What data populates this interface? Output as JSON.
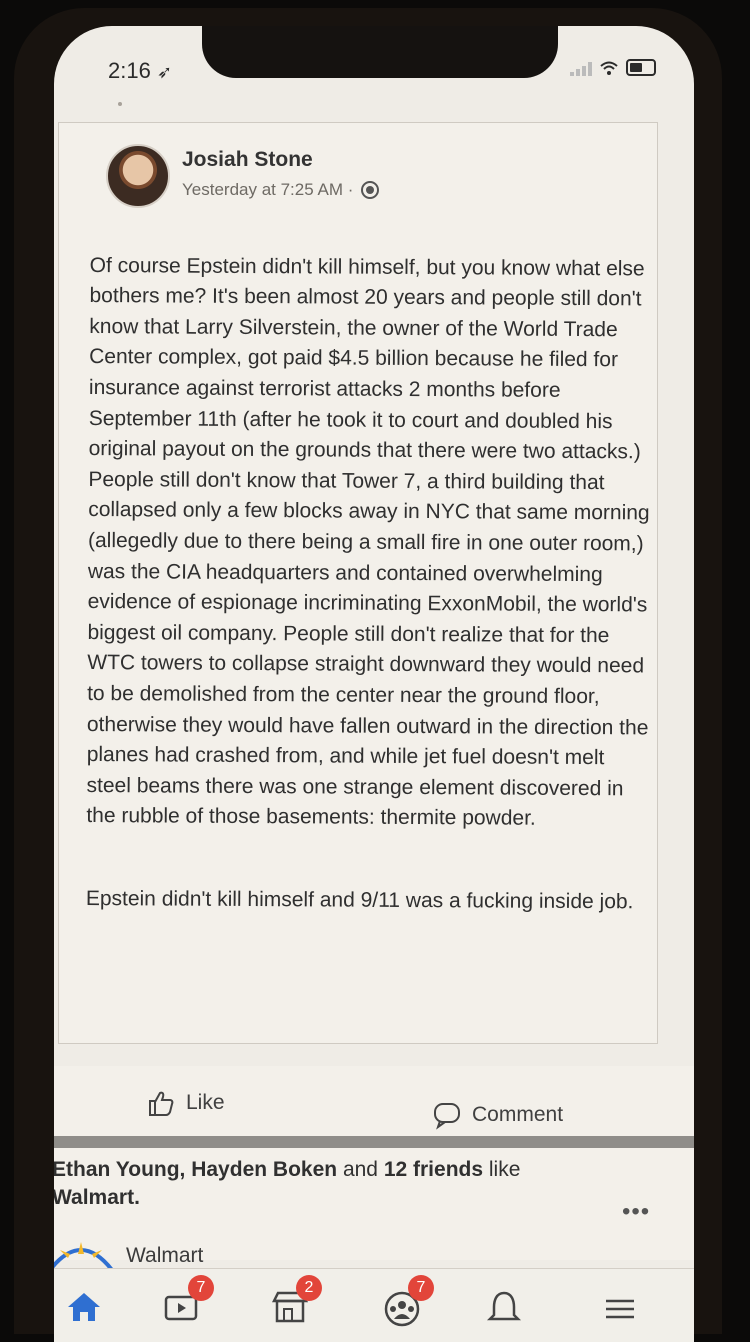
{
  "status_bar": {
    "time": "2:16"
  },
  "post": {
    "author": "Josiah Stone",
    "timestamp": "Yesterday at 7:25 AM ·",
    "paragraph1": "Of course Epstein didn't kill himself, but you know what else bothers me? It's been almost 20 years and people still don't know that Larry Silverstein, the owner of the World Trade Center complex, got paid $4.5 billion because he filed for insurance against terrorist attacks 2 months before September 11th (after he took it to court and doubled his original payout on the grounds that there were two attacks.) People still don't know that Tower 7, a third building that collapsed only a few blocks away in NYC that same morning (allegedly due to there being a small fire in one outer room,) was the CIA headquarters and contained overwhelming evidence of espionage incriminating ExxonMobil, the world's biggest oil company. People still don't realize that for the WTC towers to collapse straight downward they would need to be demolished from the center near the ground floor, otherwise they would have fallen outward in the direction the planes had crashed from, and while jet fuel doesn't melt steel beams there was one strange element discovered in the rubble of those basements: thermite powder.",
    "paragraph2": "Epstein didn't kill himself and 9/11 was a fucking inside job."
  },
  "actions": {
    "like_label": "Like",
    "comment_label": "Comment"
  },
  "social": {
    "friends": "Ethan Young, Hayden Boken",
    "middle": "and",
    "count": "12 friends",
    "tail": "like",
    "page": "Walmart.",
    "page_name": "Walmart"
  },
  "tabbar": {
    "watch_badge": "7",
    "marketplace_badge": "2",
    "groups_badge": "7"
  },
  "colors": {
    "accent": "#2f6fd1",
    "badge": "#e2453a"
  },
  "icons": [
    "location-arrow-icon",
    "signal-icon",
    "wifi-icon",
    "battery-icon",
    "globe-icon",
    "like-thumb-icon",
    "comment-bubble-icon",
    "more-dots-icon",
    "home-icon",
    "watch-icon",
    "marketplace-icon",
    "groups-icon",
    "bell-icon",
    "menu-icon"
  ]
}
